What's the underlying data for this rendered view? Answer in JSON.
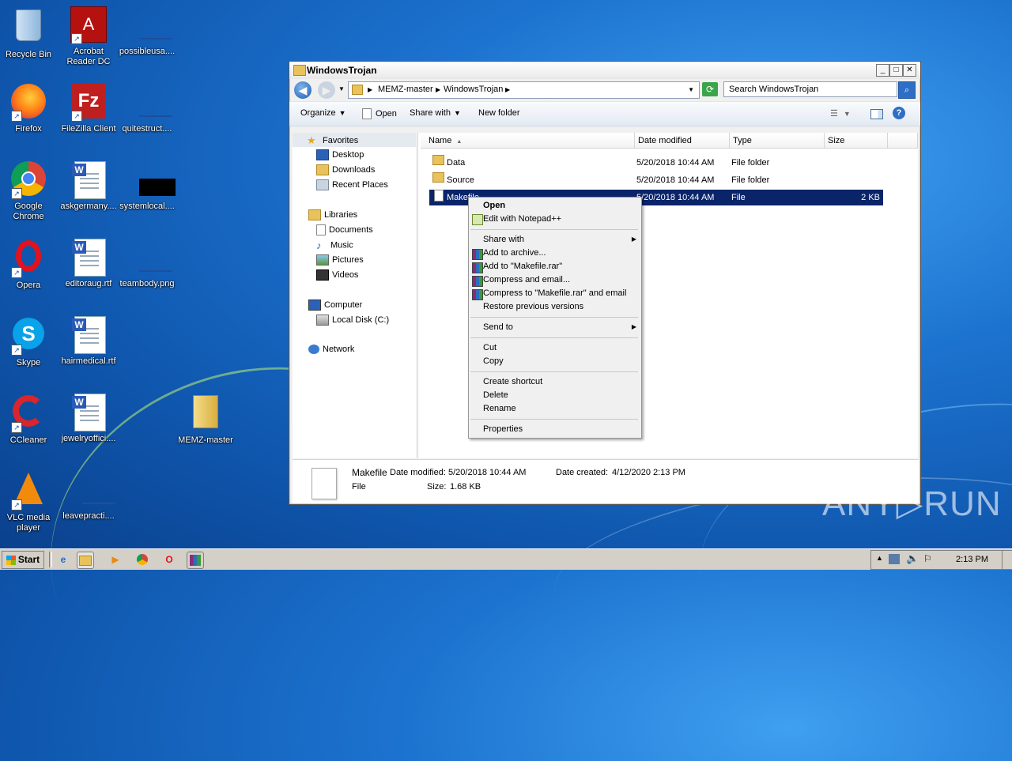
{
  "desktop": {
    "icons": [
      {
        "label": "Recycle Bin",
        "icon": "recycle-bin-icon"
      },
      {
        "label": "Acrobat Reader DC",
        "icon": "acrobat-icon"
      },
      {
        "label": "possibleusa....",
        "icon": "file-icon"
      },
      {
        "label": "Firefox",
        "icon": "firefox-icon"
      },
      {
        "label": "FileZilla Client",
        "icon": "filezilla-icon"
      },
      {
        "label": "quitestruct....",
        "icon": "file-icon"
      },
      {
        "label": "Google Chrome",
        "icon": "chrome-icon"
      },
      {
        "label": "askgermany....",
        "icon": "word-doc-icon"
      },
      {
        "label": "systemlocal....",
        "icon": "image-icon"
      },
      {
        "label": "Opera",
        "icon": "opera-icon"
      },
      {
        "label": "editoraug.rtf",
        "icon": "word-doc-icon"
      },
      {
        "label": "teambody.png",
        "icon": "image-icon"
      },
      {
        "label": "Skype",
        "icon": "skype-icon"
      },
      {
        "label": "hairmedical.rtf",
        "icon": "word-doc-icon"
      },
      {
        "label": "CCleaner",
        "icon": "ccleaner-icon"
      },
      {
        "label": "jewelryoffici....",
        "icon": "word-doc-icon"
      },
      {
        "label": "MEMZ-master",
        "icon": "folder-icon"
      },
      {
        "label": "VLC media player",
        "icon": "vlc-icon"
      },
      {
        "label": "leavepracti....",
        "icon": "file-icon"
      }
    ]
  },
  "window": {
    "title": "WindowsTrojan",
    "controls": {
      "minimize": "_",
      "maximize": "□",
      "close": "✕"
    },
    "breadcrumb": [
      "MEMZ-master",
      "WindowsTrojan"
    ],
    "search_placeholder": "Search WindowsTrojan",
    "toolbar": {
      "organize": "Organize",
      "open": "Open",
      "share_with": "Share with",
      "new_folder": "New folder"
    },
    "nav": {
      "favorites": "Favorites",
      "desktop": "Desktop",
      "downloads": "Downloads",
      "recent_places": "Recent Places",
      "libraries": "Libraries",
      "documents": "Documents",
      "music": "Music",
      "pictures": "Pictures",
      "videos": "Videos",
      "computer": "Computer",
      "local_disk": "Local Disk (C:)",
      "network": "Network"
    },
    "columns": {
      "name": "Name",
      "date": "Date modified",
      "type": "Type",
      "size": "Size"
    },
    "files": [
      {
        "name": "Data",
        "date": "5/20/2018 10:44 AM",
        "type": "File folder",
        "size": ""
      },
      {
        "name": "Source",
        "date": "5/20/2018 10:44 AM",
        "type": "File folder",
        "size": ""
      },
      {
        "name": "Makefile",
        "date": "5/20/2018 10:44 AM",
        "type": "File",
        "size": "2 KB"
      }
    ],
    "details": {
      "name": "Makefile",
      "date_modified_label": "Date modified:",
      "date_modified": "5/20/2018 10:44 AM",
      "date_created_label": "Date created:",
      "date_created": "4/12/2020 2:13 PM",
      "type": "File",
      "size_label": "Size:",
      "size": "1.68 KB"
    }
  },
  "context_menu": {
    "open": "Open",
    "edit_notepad": "Edit with Notepad++",
    "share_with": "Share with",
    "add_archive": "Add to archive...",
    "add_rar": "Add to \"Makefile.rar\"",
    "compress_email": "Compress and email...",
    "compress_rar_email": "Compress to \"Makefile.rar\" and email",
    "restore": "Restore previous versions",
    "send_to": "Send to",
    "cut": "Cut",
    "copy": "Copy",
    "create_shortcut": "Create shortcut",
    "delete": "Delete",
    "rename": "Rename",
    "properties": "Properties"
  },
  "taskbar": {
    "start": "Start",
    "clock": "2:13 PM"
  },
  "watermark": "ANY▷RUN"
}
